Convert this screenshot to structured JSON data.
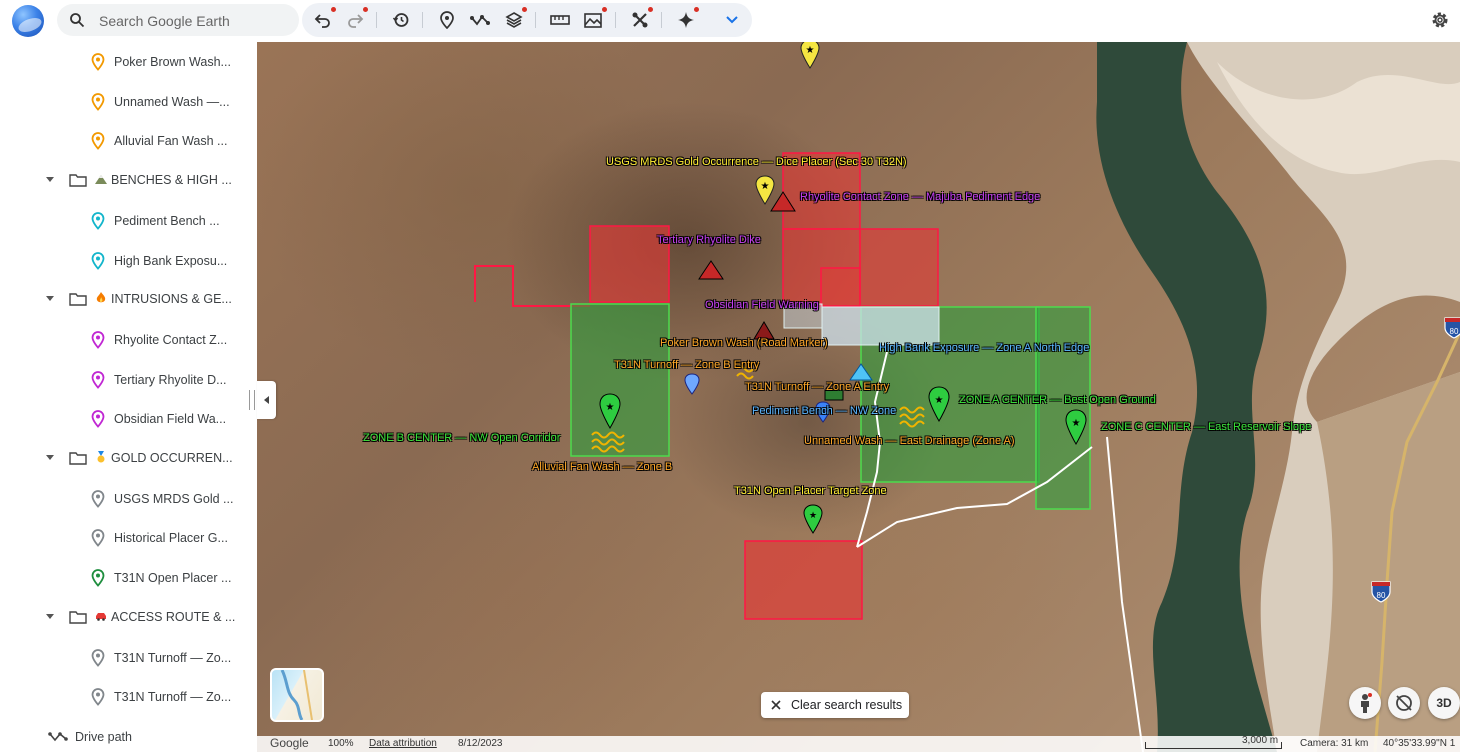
{
  "search": {
    "placeholder": "Search Google Earth"
  },
  "sidebar": {
    "items": [
      {
        "label": "Poker Brown Wash...",
        "pin_color": "#f29900",
        "type": "placemark"
      },
      {
        "label": "Unnamed Wash —...",
        "pin_color": "#f29900",
        "type": "placemark"
      },
      {
        "label": "Alluvial Fan Wash ...",
        "pin_color": "#f29900",
        "type": "placemark"
      },
      {
        "label": "BENCHES & HIGH ...",
        "type": "folder",
        "emoji": "mountain-icon"
      },
      {
        "label": "Pediment Bench ...",
        "pin_color": "#12b5cb",
        "type": "placemark"
      },
      {
        "label": "High Bank Exposu...",
        "pin_color": "#12b5cb",
        "type": "placemark"
      },
      {
        "label": "INTRUSIONS & GE...",
        "type": "folder",
        "emoji": "fire-icon"
      },
      {
        "label": "Rhyolite Contact Z...",
        "pin_color": "#c026d3",
        "type": "placemark"
      },
      {
        "label": "Tertiary Rhyolite D...",
        "pin_color": "#c026d3",
        "type": "placemark"
      },
      {
        "label": "Obsidian Field Wa...",
        "pin_color": "#c026d3",
        "type": "placemark"
      },
      {
        "label": "GOLD OCCURREN...",
        "type": "folder",
        "emoji": "medal-icon"
      },
      {
        "label": "USGS MRDS Gold ...",
        "pin_color": "#80868b",
        "type": "placemark"
      },
      {
        "label": "Historical Placer G...",
        "pin_color": "#80868b",
        "type": "placemark"
      },
      {
        "label": "T31N Open Placer ...",
        "pin_color": "#1e8e3e",
        "type": "placemark"
      },
      {
        "label": "ACCESS ROUTE & ...",
        "type": "folder",
        "emoji": "car-icon"
      },
      {
        "label": "T31N Turnoff — Zo...",
        "pin_color": "#80868b",
        "type": "placemark"
      },
      {
        "label": "T31N Turnoff — Zo...",
        "pin_color": "#80868b",
        "type": "placemark"
      },
      {
        "label": "Drive path",
        "type": "path"
      }
    ]
  },
  "map": {
    "labels": [
      {
        "text": "USGS MRDS Gold Occurrence — Dice Placer (Sec 30 T32N)",
        "color": "yellow"
      },
      {
        "text": "Rhyolite Contact Zone — Majuba Pediment Edge",
        "color": "purple"
      },
      {
        "text": "Tertiary Rhyolite Dike",
        "color": "purple"
      },
      {
        "text": "Obsidian Field Warning",
        "color": "purple"
      },
      {
        "text": "Poker Brown Wash (Road Marker)",
        "color": "orange"
      },
      {
        "text": "T31N Turnoff — Zone B Entry",
        "color": "orange"
      },
      {
        "text": "High Bank Exposure — Zone A North Edge",
        "color": "blue"
      },
      {
        "text": "T31N Turnoff — Zone A Entry",
        "color": "orange"
      },
      {
        "text": "ZONE A CENTER — Best Open Ground",
        "color": "green"
      },
      {
        "text": "Pediment Bench — NW Zone",
        "color": "blue"
      },
      {
        "text": "ZONE C CENTER — East Reservoir Slope",
        "color": "green"
      },
      {
        "text": "Unnamed Wash — East Drainage (Zone A)",
        "color": "orange"
      },
      {
        "text": "ZONE B CENTER — NW Open Corridor",
        "color": "green"
      },
      {
        "text": "Alluvial Fan Wash — Zone B",
        "color": "orange"
      },
      {
        "text": "T31N Open Placer Target Zone",
        "color": "yellow"
      }
    ],
    "highway_shield": "80"
  },
  "buttons": {
    "clear_search": "Clear search results",
    "view_3d": "3D"
  },
  "status": {
    "google": "Google",
    "zoom": "100%",
    "attribution": "Data attribution",
    "date": "8/12/2023",
    "scale": "3,000 m",
    "camera": "Camera: 31 km",
    "coords": "40°35'33.99\"N 1"
  }
}
